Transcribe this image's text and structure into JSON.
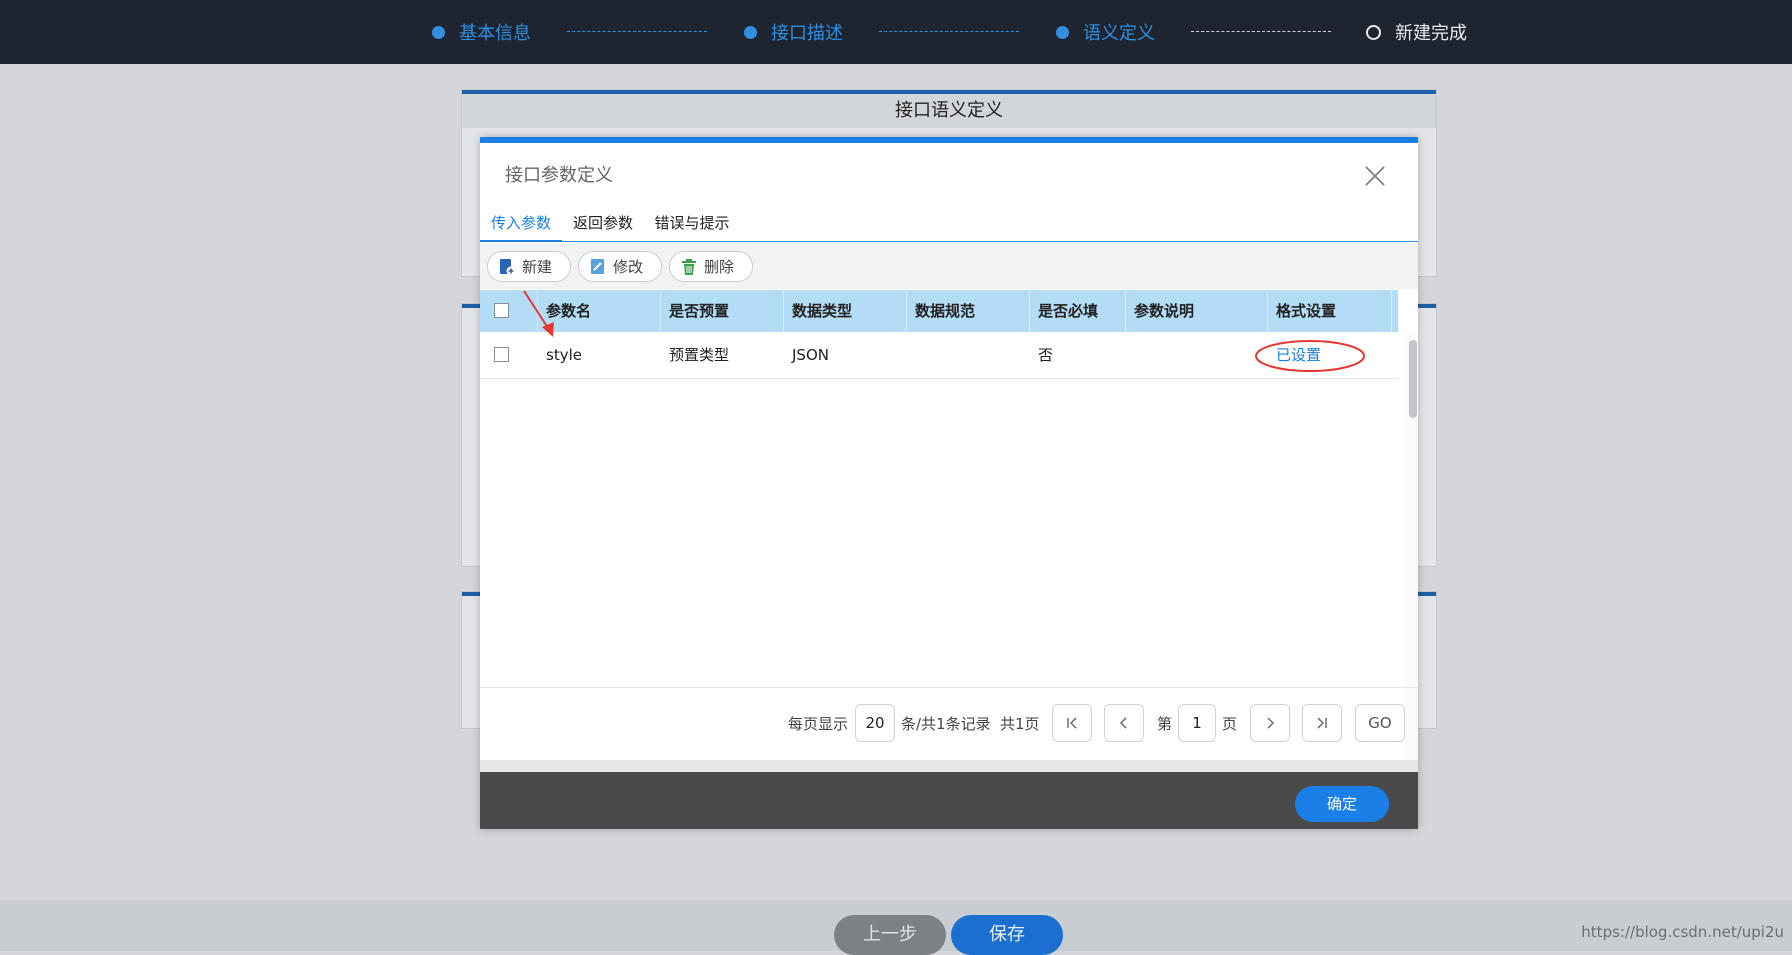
{
  "steps": [
    {
      "label": "基本信息",
      "state": "done"
    },
    {
      "label": "接口描述",
      "state": "done"
    },
    {
      "label": "语义定义",
      "state": "current"
    },
    {
      "label": "新建完成",
      "state": "pending"
    }
  ],
  "background": {
    "panel_title": "接口语义定义",
    "prev_label": "上一步",
    "save_label": "保存"
  },
  "modal": {
    "title": "接口参数定义",
    "tabs": [
      "传入参数",
      "返回参数",
      "错误与提示"
    ],
    "active_tab": 0,
    "toolbar": {
      "new_label": "新建",
      "edit_label": "修改",
      "delete_label": "删除"
    },
    "table": {
      "columns": [
        "参数名",
        "是否预置",
        "数据类型",
        "数据规范",
        "是否必填",
        "参数说明",
        "格式设置"
      ],
      "rows": [
        {
          "name": "style",
          "preset": "预置类型",
          "type": "JSON",
          "spec": "",
          "required": "否",
          "desc": "",
          "format": "已设置"
        }
      ]
    },
    "pager": {
      "per_page_label": "每页显示",
      "per_page": "20",
      "summary": "条/共1条记录",
      "total_pages": "共1页",
      "page_prefix": "第",
      "page": "1",
      "page_suffix": "页",
      "go_label": "GO"
    },
    "ok_label": "确定"
  },
  "watermark": "https://blog.csdn.net/upi2u",
  "colors": {
    "accent": "#1a7fe6",
    "header_bg": "#1e2530",
    "table_head": "#b3dcf6",
    "annotation_red": "#e53935"
  }
}
